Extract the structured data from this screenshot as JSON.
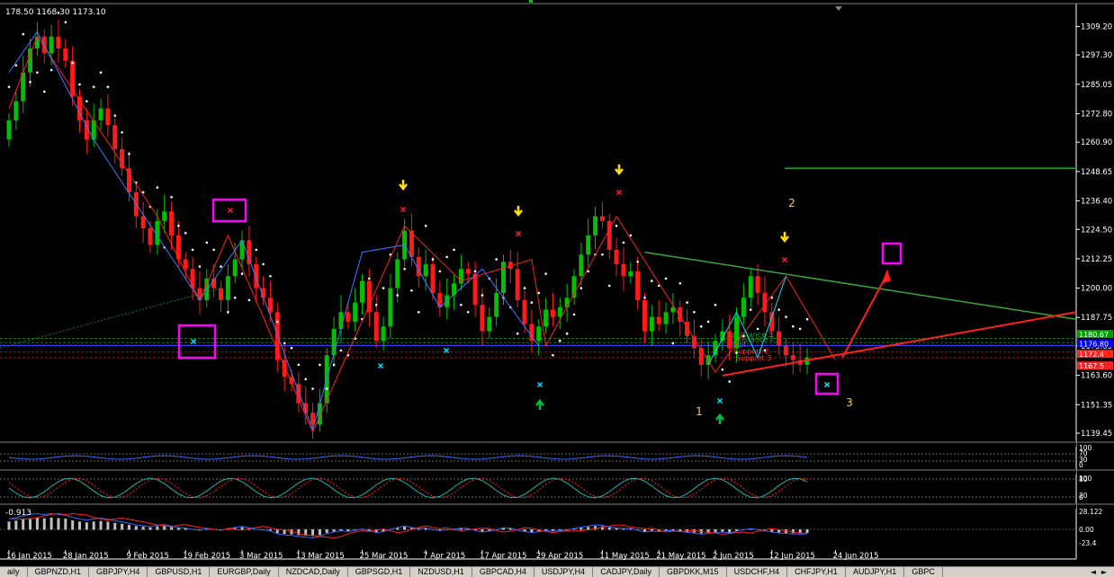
{
  "ohlc_header": "178.50 1168.30 1173.10",
  "macd_value": "-0.913",
  "tabs": [
    "aily",
    "GBPNZD,H1",
    "GBPJPY,H4",
    "GBPUSD,H1",
    "EURGBP,Daily",
    "NZDCAD,Daily",
    "GBPSGD,H1",
    "NZDUSD,H1",
    "GBPCAD,H4",
    "USDJPY,H4",
    "CADJPY,Daily",
    "GBPDKK,M15",
    "USDCHF,H4",
    "CHFJPY,H1",
    "AUDJPY,H1",
    "GBPC"
  ],
  "tab_arrows": [
    "◄",
    "►"
  ],
  "colors": {
    "bull": "#00c000",
    "bear": "#ff1a1a",
    "psar": "#ffffff",
    "zigzag_red": "#ff2020",
    "zigzag_blue": "#3355ff",
    "trend_green": "#2e9e2e",
    "resistance": "#0b8a0b",
    "support": "#cc0000",
    "pivot": "#3344ff",
    "arrow_yellow": "#ffe000",
    "arrow_green": "#00c040",
    "marker": "#ff00ff",
    "cross_cyan": "#00e0ff",
    "cross_red": "#ff2020"
  },
  "chart_data": {
    "type": "candlestick",
    "symbol_period": "Daily",
    "ylim": [
      1139.45,
      1315.0
    ],
    "price_ticks": [
      1309.2,
      1297.3,
      1285.05,
      1272.8,
      1260.9,
      1248.65,
      1236.4,
      1224.5,
      1212.25,
      1200.0,
      1187.75,
      1175.85,
      1163.6,
      1151.35,
      1139.45
    ],
    "price_tags": [
      {
        "value": 1180.67,
        "text": "1180.67",
        "color": "#00a000"
      },
      {
        "value": 1176.8,
        "text": "1176.80",
        "color": "#0000ff"
      },
      {
        "value": 1172.4,
        "text": "1172.4",
        "color": "#ff2020"
      },
      {
        "value": 1167.5,
        "text": "1167.5",
        "color": "#ff2020"
      }
    ],
    "date_labels": [
      {
        "i": 0,
        "text": "16 Jan 2015"
      },
      {
        "i": 8,
        "text": "28 Jan 2015"
      },
      {
        "i": 17,
        "text": "9 Feb 2015"
      },
      {
        "i": 25,
        "text": "19 Feb 2015"
      },
      {
        "i": 33,
        "text": "3 Mar 2015"
      },
      {
        "i": 41,
        "text": "13 Mar 2015"
      },
      {
        "i": 50,
        "text": "25 Mar 2015"
      },
      {
        "i": 59,
        "text": "7 Apr 2015"
      },
      {
        "i": 67,
        "text": "17 Apr 2015"
      },
      {
        "i": 75,
        "text": "29 Apr 2015"
      },
      {
        "i": 84,
        "text": "11 May 2015"
      },
      {
        "i": 92,
        "text": "21 May 2015"
      },
      {
        "i": 100,
        "text": "2 Jun 2015"
      },
      {
        "i": 108,
        "text": "12 Jun 2015"
      },
      {
        "i": 117,
        "text": "24 Jun 2015"
      }
    ],
    "closes": [
      1270,
      1278,
      1290,
      1300,
      1305,
      1298,
      1305,
      1300,
      1295,
      1280,
      1270,
      1262,
      1270,
      1275,
      1268,
      1258,
      1250,
      1240,
      1230,
      1225,
      1218,
      1228,
      1232,
      1222,
      1212,
      1208,
      1200,
      1195,
      1204,
      1200,
      1195,
      1205,
      1212,
      1220,
      1210,
      1200,
      1196,
      1190,
      1170,
      1163,
      1160,
      1152,
      1148,
      1143,
      1152,
      1172,
      1183,
      1190,
      1186,
      1194,
      1203,
      1190,
      1178,
      1184,
      1200,
      1212,
      1224,
      1213,
      1205,
      1210,
      1198,
      1192,
      1197,
      1202,
      1208,
      1206,
      1193,
      1182,
      1188,
      1198,
      1211,
      1208,
      1195,
      1185,
      1178,
      1184,
      1191,
      1188,
      1192,
      1196,
      1205,
      1214,
      1222,
      1230,
      1228,
      1216,
      1210,
      1205,
      1207,
      1195,
      1182,
      1188,
      1185,
      1190,
      1192,
      1186,
      1180,
      1175,
      1168,
      1172,
      1178,
      1182,
      1175,
      1188,
      1196,
      1205,
      1198,
      1190,
      1182,
      1176,
      1172,
      1170,
      1168,
      1171
    ],
    "psar_pattern_note": "Parabolic SAR dots",
    "levels": [
      {
        "value": 1179.0,
        "label": "Resistance 3",
        "color": "#0b8a0b"
      },
      {
        "value": 1177.3,
        "label": "Resistance 2",
        "color": "#0b8a0b"
      },
      {
        "value": 1176.0,
        "label": "Pivot",
        "color": "#3344ff"
      },
      {
        "value": 1173.3,
        "label": "Support 2",
        "color": "#cc0000"
      },
      {
        "value": 1171.0,
        "label": "Support 3",
        "color": "#cc0000"
      }
    ],
    "annotations": [
      {
        "text": "1",
        "i": 102,
        "value": 1153
      },
      {
        "text": "2",
        "i": 117,
        "value": 1236
      },
      {
        "text": "3",
        "i": 124,
        "value": 1157
      }
    ],
    "indicator_panels": [
      {
        "name": "rsi",
        "ticks": [
          "100",
          "70",
          "30",
          "0"
        ]
      },
      {
        "name": "stochastic",
        "ticks": [
          "100",
          "80",
          "20",
          "0"
        ]
      },
      {
        "name": "macd",
        "ticks": [
          "28.122",
          "0.00",
          "-23.4"
        ]
      }
    ]
  }
}
